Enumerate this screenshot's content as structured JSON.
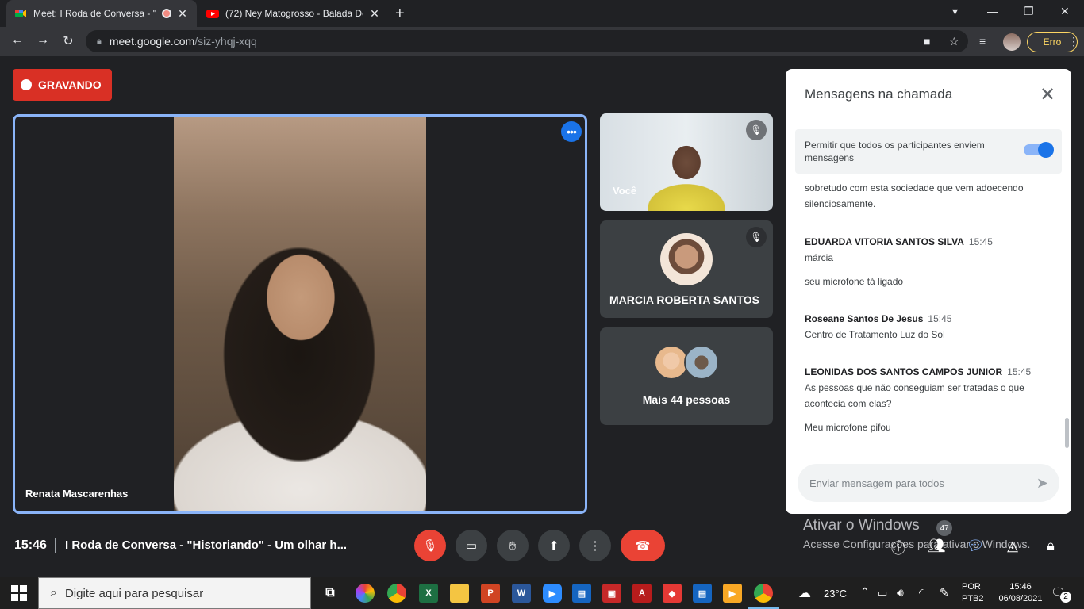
{
  "browser": {
    "tabs": [
      {
        "title": "Meet: I Roda de Conversa - \"",
        "favicon": "google-meet-icon",
        "active": true
      },
      {
        "title": "(72) Ney Matogrosso - Balada Do",
        "favicon": "youtube-icon",
        "active": false
      }
    ],
    "new_tab": "+",
    "window_controls": {
      "minimize": "—",
      "maximize": "❐",
      "close": "✕"
    },
    "url_host": "meet.google.com",
    "url_path": "/siz-yhqj-xqq",
    "erro_label": "Erro"
  },
  "meet": {
    "recording_label": "GRAVANDO",
    "main_participant": {
      "name": "Renata Mascarenhas"
    },
    "side_tiles": [
      {
        "name": "Você",
        "muted": true
      },
      {
        "name": "MARCIA ROBERTA SANTOS",
        "muted": true
      },
      {
        "label": "Mais 44 pessoas"
      }
    ],
    "chat": {
      "title": "Mensagens na chamada",
      "permission_text": "Permitir que todos os participantes enviem mensagens",
      "permission_enabled": true,
      "messages": [
        {
          "sender": "",
          "time": "",
          "lines": [
            "sobretudo com esta sociedade que vem adoecendo silenciosamente."
          ]
        },
        {
          "sender": "EDUARDA VITORIA SANTOS SILVA",
          "time": "15:45",
          "lines": [
            "márcia",
            "seu microfone tá ligado"
          ]
        },
        {
          "sender": "Roseane Santos De Jesus",
          "time": "15:45",
          "lines": [
            "Centro de Tratamento Luz do Sol"
          ]
        },
        {
          "sender": "LEONIDAS DOS SANTOS CAMPOS JUNIOR",
          "time": "15:45",
          "lines": [
            "As pessoas que não conseguiam ser tratadas o que acontecia com elas?",
            "Meu microfone pifou"
          ]
        }
      ],
      "input_placeholder": "Enviar mensagem para todos"
    },
    "bottom": {
      "time": "15:46",
      "meeting_title": "I Roda de Conversa - \"Historiando\" - Um olhar h...",
      "participants_count": "47"
    },
    "watermark": {
      "line1": "Ativar o Windows",
      "line2": "Acesse Configurações para ativar o Windows."
    }
  },
  "taskbar": {
    "search_placeholder": "Digite aqui para pesquisar",
    "weather": "23°C",
    "language": "POR",
    "layout": "PTB2",
    "time": "15:46",
    "date": "06/08/2021",
    "notifications": "2"
  },
  "colors": {
    "accent_blue": "#1a73e8",
    "record_red": "#d93025",
    "dark_bg": "#202124",
    "warning_yellow": "#fdd663"
  }
}
